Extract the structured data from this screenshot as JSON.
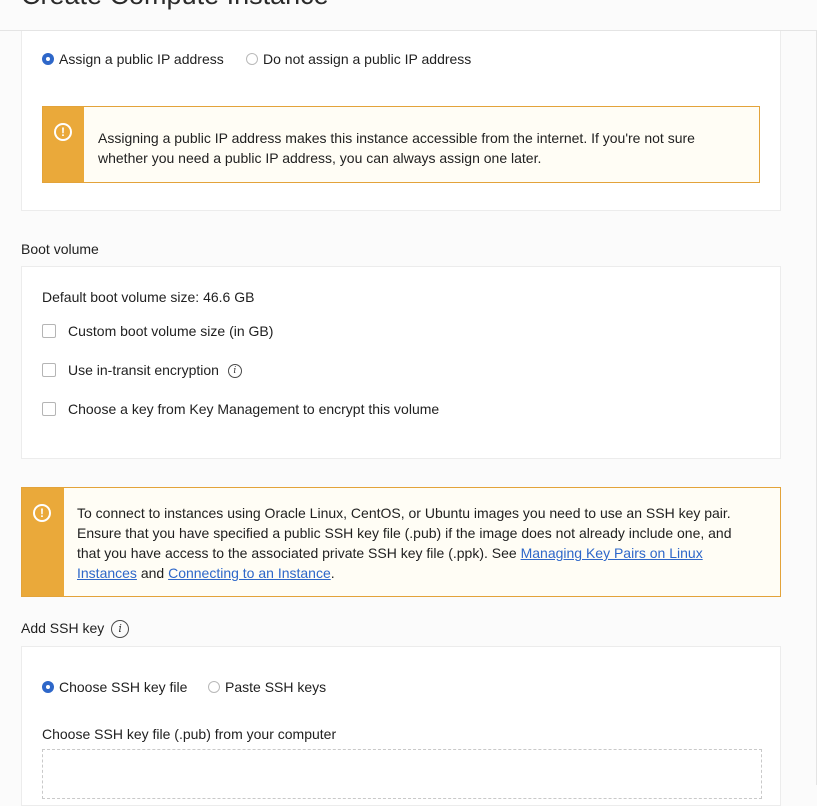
{
  "header": {
    "title": "Create Compute Instance"
  },
  "public_ip": {
    "options": [
      {
        "label": "Assign a public IP address",
        "checked": true
      },
      {
        "label": "Do not assign a public IP address",
        "checked": false
      }
    ],
    "warning": "Assigning a public IP address makes this instance accessible from the internet. If you're not sure whether you need a public IP address, you can always assign one later."
  },
  "boot_volume": {
    "heading": "Boot volume",
    "default_size": "Default boot volume size: 46.6 GB",
    "options": [
      {
        "label": "Custom boot volume size (in GB)",
        "checked": false
      },
      {
        "label": "Use in-transit encryption",
        "checked": false
      },
      {
        "label": "Choose a key from Key Management to encrypt this volume",
        "checked": false
      }
    ]
  },
  "ssh_warning": {
    "text_before": "To connect to instances using Oracle Linux, CentOS, or Ubuntu images you need to use an SSH key pair. Ensure that you have specified a public SSH key file (.pub) if the image does not already include one, and that you have access to the associated private SSH key file (.ppk). See ",
    "link1": "Managing Key Pairs on Linux Instances",
    "text_middle": " and ",
    "link2": "Connecting to an Instance",
    "text_after": "."
  },
  "ssh": {
    "heading": "Add SSH key",
    "options": [
      {
        "label": "Choose SSH key file",
        "checked": true
      },
      {
        "label": "Paste SSH keys",
        "checked": false
      }
    ],
    "file_label": "Choose SSH key file (.pub) from your computer"
  },
  "icons": {
    "warning": "exclamation-circle-icon",
    "info": "info-icon"
  },
  "colors": {
    "accent": "#2e67c9",
    "warning": "#eaa93a"
  }
}
